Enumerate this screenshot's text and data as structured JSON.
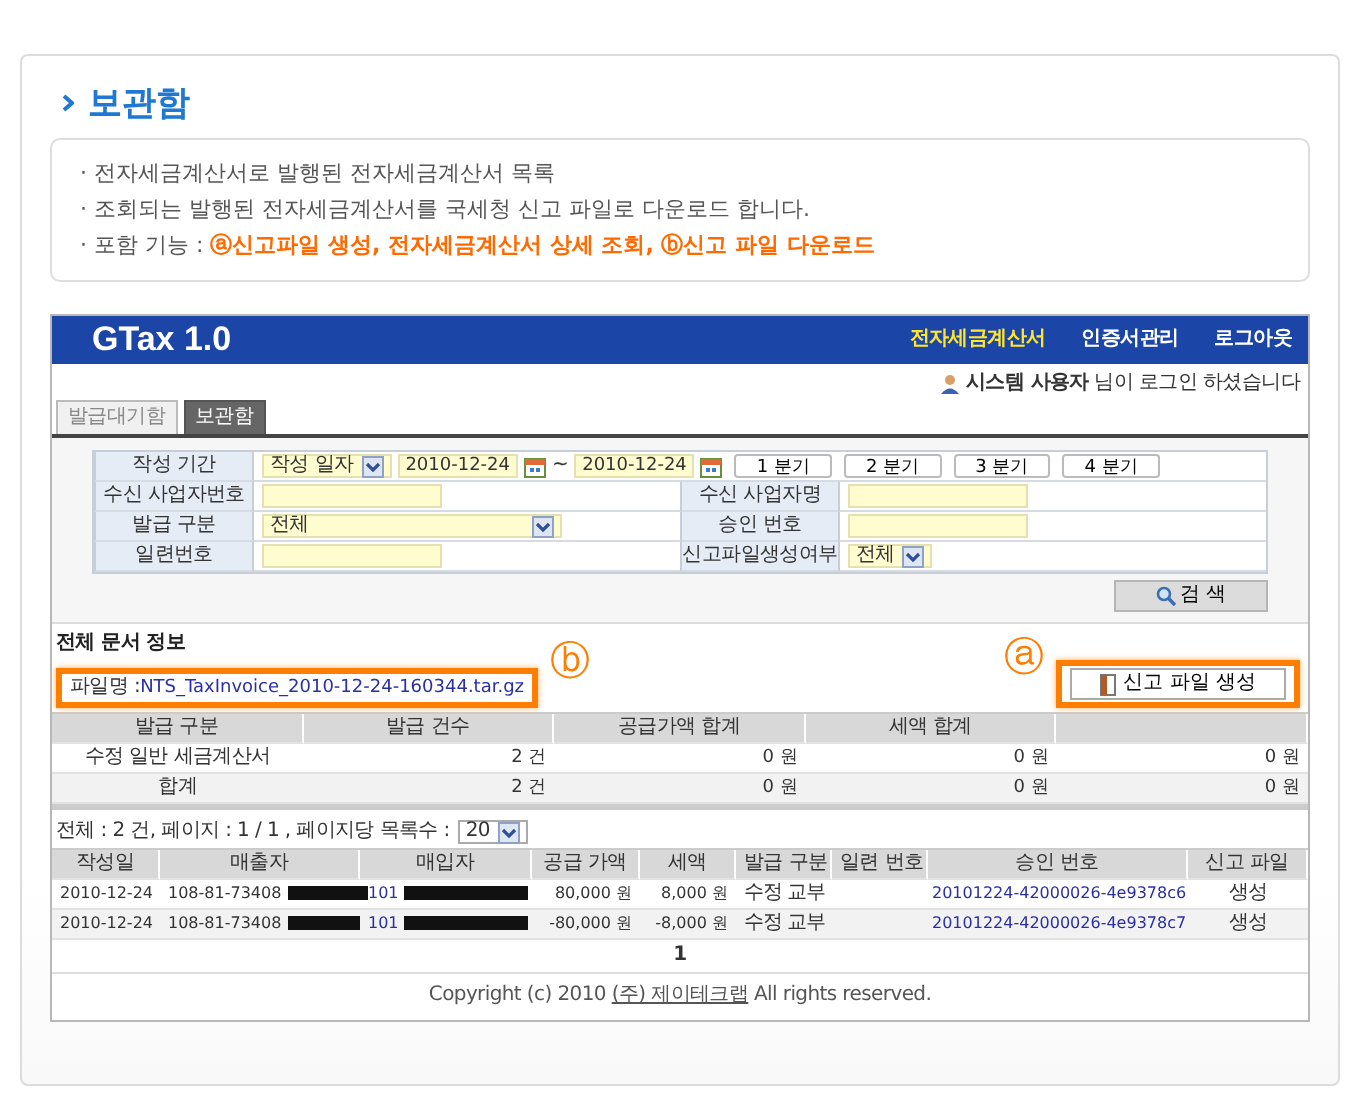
{
  "page_title": "보관함",
  "notes": [
    {
      "text": "· 전자세금계산서로 발행된 전자세금계산서 목록"
    },
    {
      "text": "· 조회되는 발행된 전자세금계산서를 국세청 신고 파일로 다운로드 합니다."
    },
    {
      "text": "· 포함 기능 : ",
      "emphasis": "ⓐ신고파일 생성, 전자세금계산서 상세 조회, ⓑ신고 파일 다운로드"
    }
  ],
  "app": {
    "logo": "GTax 1.0",
    "nav": [
      {
        "label": "전자세금계산서",
        "selected": true
      },
      {
        "label": "인증서관리",
        "selected": false
      },
      {
        "label": "로그아웃",
        "selected": false
      }
    ],
    "user": {
      "name": "시스템 사용자",
      "message": "님이 로그인 하셨습니다"
    },
    "tabs": [
      {
        "label": "발급대기함",
        "selected": false
      },
      {
        "label": "보관함",
        "selected": true
      }
    ],
    "search": {
      "period": {
        "label": "작성 기간",
        "type_value": "작성 일자",
        "from": "2010-12-24",
        "separator": "~",
        "to": "2010-12-24",
        "quarters": [
          "1 분기",
          "2 분기",
          "3 분기",
          "4 분기"
        ]
      },
      "fields": [
        {
          "label": "수신 사업자번호",
          "kind": "input"
        },
        {
          "label": "수신 사업자명",
          "kind": "input"
        },
        {
          "label": "발급 구분",
          "kind": "select",
          "value": "전체"
        },
        {
          "label": "승인 번호",
          "kind": "input"
        },
        {
          "label": "일련번호",
          "kind": "input"
        },
        {
          "label": "신고파일생성여부",
          "kind": "select",
          "value": "전체"
        }
      ],
      "button": "검 색"
    },
    "summary": {
      "title": "전체 문서 정보",
      "file_label": "파일명 : ",
      "file_name": "NTS_TaxInvoice_2010-12-24-160344.tar.gz",
      "file_marker": "ⓑ",
      "create_marker": "ⓐ",
      "create_button": "신고 파일 생성",
      "columns": [
        "발급 구분",
        "발급 건수",
        "공급가액 합계",
        "세액 합계"
      ],
      "rows": [
        [
          "수정 일반 세금계산서",
          "2 건",
          "0 원",
          "0 원",
          "0 원"
        ],
        [
          "합계",
          "2 건",
          "0 원",
          "0 원",
          "0 원"
        ]
      ]
    },
    "list": {
      "info": "전체 : 2 건, 페이지 : 1 / 1 , 페이지당 목록수 :",
      "page_size": "20",
      "columns": [
        "작성일",
        "매출자",
        "매입자",
        "공급 가액",
        "세액",
        "발급 구분",
        "일련 번호",
        "승인 번호",
        "신고 파일"
      ],
      "rows": [
        {
          "date": "2010-12-24",
          "seller": "108-81-73408",
          "buyer": "101",
          "supply": "80,000 원",
          "tax": "8,000 원",
          "issue": "수정 교부",
          "approval": "20101224-42000026-4e9378c6",
          "file": "생성"
        },
        {
          "date": "2010-12-24",
          "seller": "108-81-73408",
          "buyer": "101",
          "supply": "-80,000 원",
          "tax": "-8,000 원",
          "issue": "수정 교부",
          "approval": "20101224-42000026-4e9378c7",
          "file": "생성"
        }
      ],
      "pages": [
        "1"
      ]
    },
    "footer": {
      "prefix": "Copyright (c) 2010 ",
      "link": "(주) 제이테크랩",
      "suffix": " All rights reserved."
    }
  }
}
